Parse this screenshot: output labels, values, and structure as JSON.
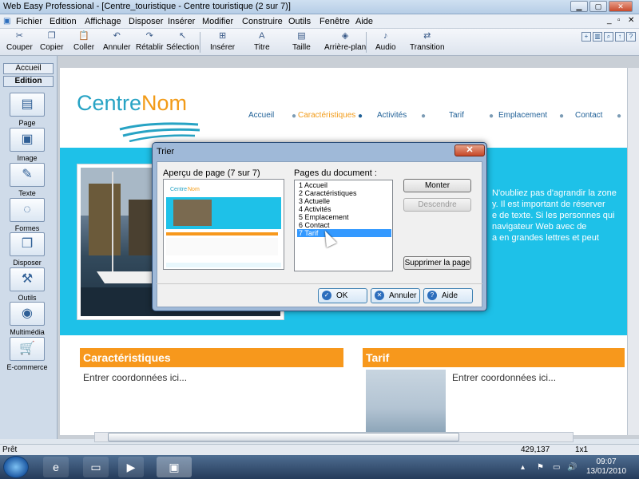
{
  "window": {
    "title": "Web Easy Professional - [Centre_touristique - Centre touristique (2 sur 7)]"
  },
  "menu": [
    "Fichier",
    "Edition",
    "Affichage",
    "Disposer",
    "Insérer",
    "Modifier",
    "Construire",
    "Outils",
    "Fenêtre",
    "Aide"
  ],
  "toolbar": {
    "items": [
      {
        "label": "Couper",
        "icon": "scissors-icon"
      },
      {
        "label": "Copier",
        "icon": "copy-icon"
      },
      {
        "label": "Coller",
        "icon": "paste-icon"
      },
      {
        "label": "Annuler",
        "icon": "undo-icon"
      },
      {
        "label": "Rétablir",
        "icon": "redo-icon"
      },
      {
        "label": "Sélection",
        "icon": "pointer-icon"
      },
      {
        "label": "Insérer",
        "icon": "insert-icon"
      },
      {
        "label": "Titre",
        "icon": "title-icon"
      },
      {
        "label": "Taille",
        "icon": "size-icon"
      },
      {
        "label": "Arrière-plan",
        "icon": "background-icon"
      },
      {
        "label": "Audio",
        "icon": "audio-icon"
      },
      {
        "label": "Transition",
        "icon": "transition-icon"
      }
    ]
  },
  "left_panel": {
    "tabs": [
      "Accueil",
      "Edition"
    ],
    "items": [
      {
        "label": "Page",
        "icon": "page-icon"
      },
      {
        "label": "Image",
        "icon": "image-icon"
      },
      {
        "label": "Texte",
        "icon": "text-icon"
      },
      {
        "label": "Formes",
        "icon": "shapes-icon"
      },
      {
        "label": "Disposer",
        "icon": "arrange-icon"
      },
      {
        "label": "Outils",
        "icon": "tools-icon"
      },
      {
        "label": "Multimédia",
        "icon": "multimedia-icon"
      },
      {
        "label": "E-commerce",
        "icon": "cart-icon"
      }
    ]
  },
  "site": {
    "logo_part1": "Centre",
    "logo_part2": "Nom",
    "nav": [
      "Accueil",
      "Caractéristiques",
      "Activités",
      "Tarif",
      "Emplacement",
      "Contact"
    ],
    "band_text": "N'oubliez pas d'agrandir la zone ... Il est important de réserver ... de texte. Si les personnes qui ... navigateur Web avec de ... en grandes lettres et peut",
    "band_lines": [
      "N'oubliez pas d'agrandir la zone",
      "y. Il est important de réserver",
      "e de texte. Si les personnes qui",
      "navigateur Web avec de",
      "a en grandes lettres et peut"
    ],
    "section1_title": "Caractéristiques",
    "section1_body": "Entrer coordonnées ici...",
    "section2_title": "Tarif",
    "section2_body": "Entrer coordonnées ici..."
  },
  "dialog": {
    "title": "Trier",
    "preview_label": "Aperçu de page (7 sur 7)",
    "pages_label": "Pages du document :",
    "pages": [
      "1  Accueil",
      "2  Caractéristiques",
      "3  Actuelle",
      "4  Activités",
      "5  Emplacement",
      "6  Contact",
      "7  Tarif"
    ],
    "selected_index": 6,
    "btn_up": "Monter",
    "btn_down": "Descendre",
    "btn_delete": "Supprimer la page",
    "btn_ok": "OK",
    "btn_cancel": "Annuler",
    "btn_help": "Aide"
  },
  "status": {
    "left": "Prêt",
    "coords": "429,137",
    "size": "1x1"
  },
  "clock": {
    "time": "09:07",
    "date": "13/01/2010"
  },
  "colors": {
    "accent_blue": "#1ec1e8",
    "orange": "#f7981c",
    "logo_blue": "#27a3c4"
  }
}
